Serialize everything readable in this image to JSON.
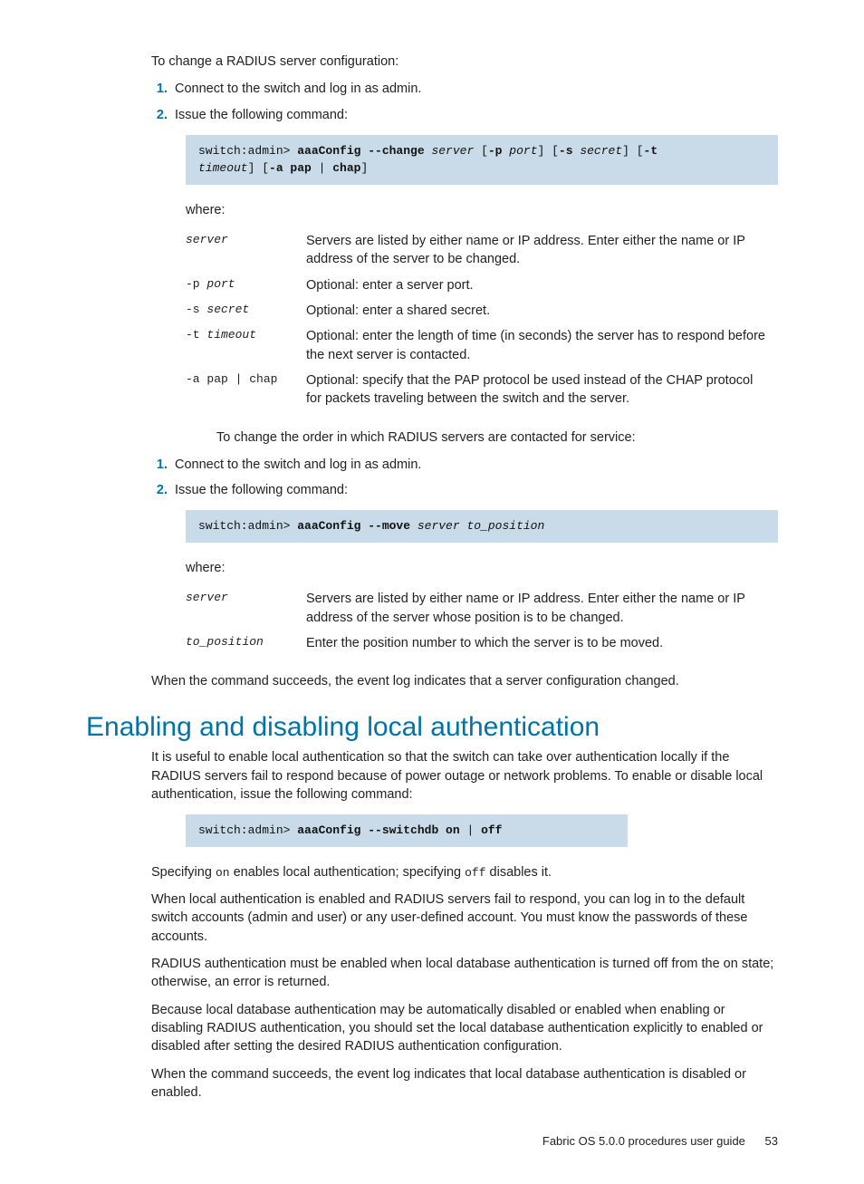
{
  "intro1": "To change a RADIUS server configuration:",
  "steps1": [
    "Connect to the switch and log in as admin.",
    "Issue the following command:"
  ],
  "code1": {
    "prompt": "switch:admin> ",
    "cmd": "aaaConfig --change",
    "arg1": " server",
    "seg_p1": " [",
    "flag_p": "-p",
    "arg_p": " port",
    "seg_p2": "] [",
    "flag_s": "-s",
    "arg_s": " secret",
    "seg_s2": "] [",
    "flag_t": "-t",
    "arg_t_line": " ",
    "arg_t_line2": "timeout",
    "seg_t2": "] [",
    "flag_a": "-a pap",
    "pipe": " | ",
    "chap": "chap",
    "end": "]"
  },
  "where": "where:",
  "params1": [
    {
      "name": "server",
      "italic": true,
      "desc": "Servers are listed by either name or IP address. Enter either the name or IP address of the server to be changed."
    },
    {
      "name": "-p port",
      "italic_part": "port",
      "desc": "Optional: enter a server port."
    },
    {
      "name": "-s secret",
      "italic_part": "secret",
      "desc": "Optional: enter a shared secret."
    },
    {
      "name": "-t timeout",
      "italic_part": "timeout",
      "desc": "Optional: enter the length of time (in seconds) the server has to respond before the next server is contacted."
    },
    {
      "name": "-a pap | chap",
      "desc": "Optional: specify that the PAP protocol be used instead of the CHAP protocol for packets traveling between the switch and the server."
    }
  ],
  "intro2": "To change the order in which RADIUS servers are contacted for service:",
  "steps2": [
    "Connect to the switch and log in as admin.",
    "Issue the following command:"
  ],
  "code2": {
    "prompt": "switch:admin> ",
    "cmd": "aaaConfig --move",
    "args": " server to_position"
  },
  "params2": [
    {
      "name": "server",
      "italic": true,
      "desc": "Servers are listed by either name or IP address. Enter either the name or IP address of the server whose position is to be changed."
    },
    {
      "name": "to_position",
      "italic": true,
      "desc": "Enter the position number to which the server is to be moved."
    }
  ],
  "conclude1": "When the command succeeds, the event log indicates that a server configuration changed.",
  "heading": "Enabling and disabling local authentication",
  "body1": "It is useful to enable local authentication so that the switch can take over authentication locally if the RADIUS servers fail to respond because of power outage or network problems. To enable or disable local authentication, issue the following command:",
  "code3": {
    "prompt": "switch:admin> ",
    "cmd": "aaaConfig --switchdb on",
    "pipe": " | ",
    "off": "off"
  },
  "body2a": "Specifying ",
  "body2_on": "on",
  "body2b": " enables local authentication; specifying ",
  "body2_off": "off",
  "body2c": " disables it.",
  "body3": "When local authentication is enabled and RADIUS servers fail to respond, you can log in to the default switch accounts (admin and user) or any user-defined account. You must know the passwords of these accounts.",
  "body4": "RADIUS authentication must be enabled when local database authentication is turned off from the on state; otherwise, an error is returned.",
  "body5": "Because local database authentication may be automatically disabled or enabled when enabling or disabling RADIUS authentication, you should set the local database authentication explicitly to enabled or disabled after setting the desired RADIUS authentication configuration.",
  "body6": "When the command succeeds, the event log indicates that local database authentication is disabled or enabled.",
  "footer_text": "Fabric OS 5.0.0 procedures user guide",
  "footer_page": "53"
}
